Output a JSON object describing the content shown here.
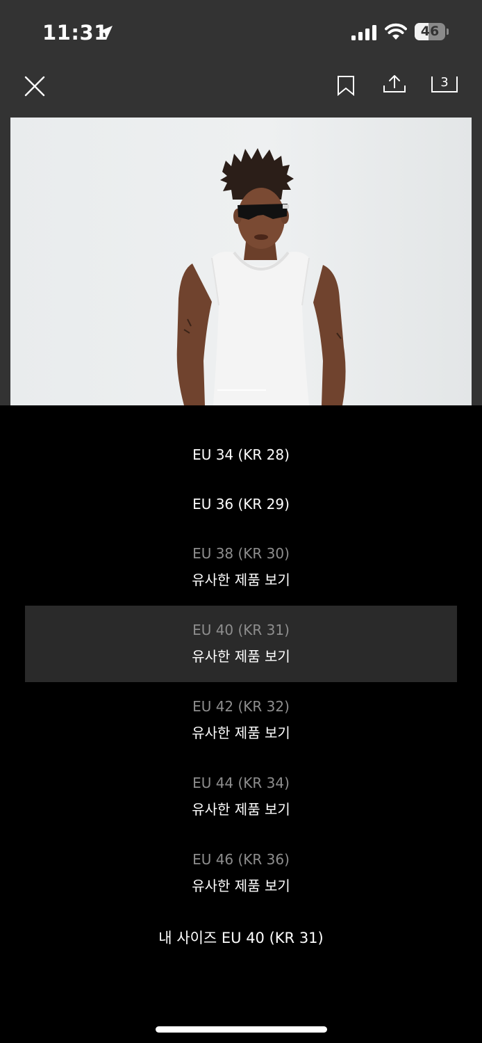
{
  "status_bar": {
    "time": "11:31",
    "battery_level": "46",
    "battery_fraction": 0.46,
    "icons": [
      "location-arrow-icon",
      "signal-bars-icon",
      "wifi-icon",
      "battery-icon"
    ]
  },
  "toolbar": {
    "icons": [
      "close-icon",
      "bookmark-icon",
      "share-icon",
      "cart-count-icon"
    ],
    "cart_count": "3"
  },
  "gallery": {
    "image_subject": "model-white-sleeveless-top",
    "current_index": 1,
    "colors": {
      "background": "#333333",
      "image_background": "#eceeef"
    }
  },
  "sizes": [
    {
      "label": "EU 34 (KR 28)",
      "available": true,
      "link": ""
    },
    {
      "label": "EU 36 (KR 29)",
      "available": true,
      "link": ""
    },
    {
      "label": "EU 38 (KR 30)",
      "available": false,
      "link": "유사한 제품 보기"
    },
    {
      "label": "EU 40 (KR 31)",
      "available": false,
      "link": "유사한 제품 보기",
      "selected": true
    },
    {
      "label": "EU 42 (KR 32)",
      "available": false,
      "link": "유사한 제품 보기"
    },
    {
      "label": "EU 44 (KR 34)",
      "available": false,
      "link": "유사한 제품 보기"
    },
    {
      "label": "EU 46 (KR 36)",
      "available": false,
      "link": "유사한 제품 보기"
    }
  ],
  "my_size": "내 사이즈 EU 40 (KR 31)",
  "colors": {
    "sheet_background": "#000000",
    "selected_row": "#2a2a2a",
    "available_text": "#ffffff",
    "unavailable_text": "#8e8e8e"
  }
}
